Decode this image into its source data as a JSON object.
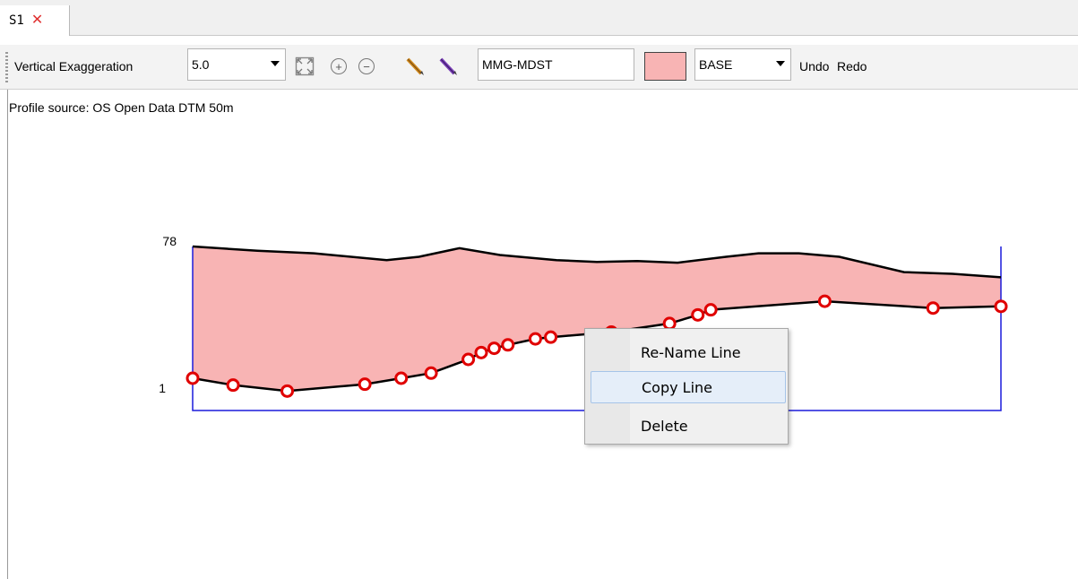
{
  "tab": {
    "label": "S1",
    "close": "✕"
  },
  "toolbar": {
    "vertical_exaggeration_label": "Vertical Exaggeration",
    "vertical_exaggeration_value": "5.0",
    "line_name": "MMG-MDST",
    "fill_color": "#f8b4b4",
    "layer_value": "BASE",
    "undo_label": "Undo",
    "redo_label": "Redo",
    "icons": [
      "zoom-fit-icon",
      "zoom-in-icon",
      "zoom-out-icon",
      "pencil-orange-icon",
      "pencil-purple-icon"
    ]
  },
  "profile": {
    "source_text": "Profile source: OS Open Data DTM 50m"
  },
  "chart_data": {
    "type": "area",
    "title": "",
    "xlabel": "",
    "ylabel": "",
    "ylim": [
      1,
      78
    ],
    "y_tick_labels": [
      "78",
      "1"
    ],
    "fill_color": "#f8b4b4",
    "frame_color": "#1c1cdc",
    "point_color": "#e00000",
    "x": [
      0,
      5,
      11.7,
      21.3,
      25.8,
      29.5,
      34.1,
      35.7,
      37.3,
      39.0,
      42.4,
      44.3,
      51.8,
      59.0,
      62.5,
      64.1,
      78.2,
      91.6,
      100
    ],
    "series": [
      {
        "name": "",
        "kind": "top",
        "x": [
          0,
          8,
          15,
          24,
          28,
          33,
          38,
          45,
          50,
          55,
          60,
          66,
          70,
          75,
          80,
          88,
          94,
          100
        ],
        "values": [
          78,
          75.5,
          74,
          70,
          72,
          77,
          73,
          70,
          69,
          69.5,
          68.5,
          72,
          74,
          74,
          72,
          63,
          62,
          60
        ]
      },
      {
        "name": "",
        "kind": "bottom",
        "values": [
          1,
          -3,
          -6.5,
          -2.5,
          1,
          4,
          12,
          16,
          18.5,
          20.5,
          24,
          25,
          28,
          33,
          38,
          41,
          46,
          42,
          43
        ]
      }
    ]
  },
  "context_menu": {
    "items": [
      {
        "label": "Re-Name Line"
      },
      {
        "label": "Copy Line"
      },
      {
        "label": "Delete"
      }
    ]
  }
}
